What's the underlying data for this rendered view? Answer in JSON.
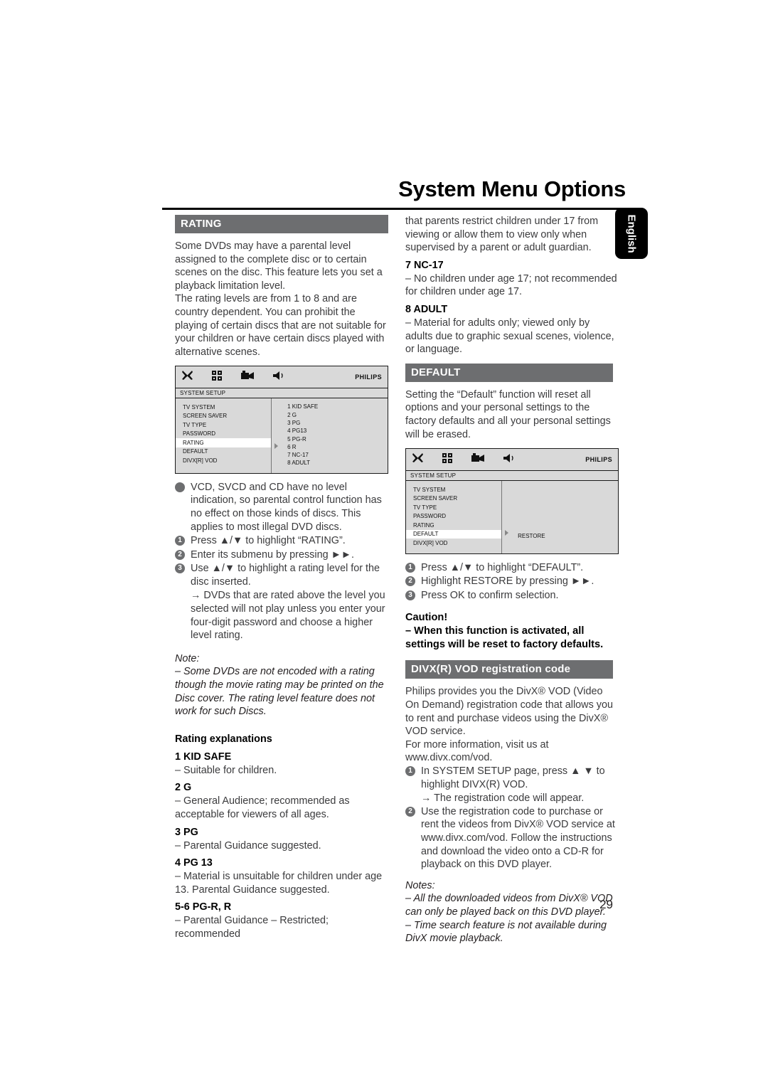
{
  "page": {
    "title": "System Menu Options",
    "language_tab": "English",
    "page_number": "29"
  },
  "left_column": {
    "rating_heading": "RATING",
    "intro_p1": "Some DVDs may have a parental level assigned to the complete disc or to certain scenes on the disc. This feature lets you set a playback limitation level.",
    "intro_p2": "The rating levels are from 1 to 8 and are country dependent. You can prohibit the playing of certain discs that are not suitable for your children or have certain discs played with alternative scenes.",
    "osd": {
      "header_label": "SYSTEM SETUP",
      "brand": "PHILIPS",
      "icons": [
        "tools-icon",
        "preferences-icon",
        "video-icon",
        "audio-icon"
      ],
      "menu_items": [
        "TV SYSTEM",
        "SCREEN SAVER",
        "TV TYPE",
        "PASSWORD",
        "RATING",
        "DEFAULT",
        "DIVX[R] VOD"
      ],
      "selected_item": "RATING",
      "options": [
        "1 KID SAFE",
        "2 G",
        "3 PG",
        "4 PG13",
        "5 PG-R",
        "6 R",
        "7 NC-17",
        "8 ADULT"
      ],
      "pointer_at_option": "6 R"
    },
    "bullet_note": "VCD, SVCD and CD have no level indication, so parental control function has no effect on those kinds of discs. This applies to most illegal DVD discs.",
    "steps": [
      "Press ▲/▼ to highlight “RATING”.",
      "Enter its submenu by pressing ►►.",
      "Use ▲/▼ to highlight a rating level for the disc inserted."
    ],
    "step_arrow": "→ DVDs that are rated above the level you selected will not play unless you enter your four-digit password and choose a higher level rating.",
    "note_label": "Note:",
    "note_text": "–  Some DVDs are not encoded with a rating though the movie rating may be printed on the Disc cover. The rating level feature does not work for such Discs.",
    "explanations_heading": "Rating explanations",
    "ratings": [
      {
        "label": "1 KID SAFE",
        "desc": "–   Suitable for children."
      },
      {
        "label": "2 G",
        "desc": "–   General Audience; recommended as acceptable for viewers of all ages."
      },
      {
        "label": "3 PG",
        "desc": "–   Parental Guidance suggested."
      },
      {
        "label": "4 PG 13",
        "desc": "–   Material is unsuitable for children under age 13. Parental Guidance suggested."
      },
      {
        "label": "5-6 PG-R, R",
        "desc": "–   Parental Guidance – Restricted; recommended"
      }
    ]
  },
  "right_column": {
    "continued_text": "that parents restrict children under 17 from viewing or allow them to view only when supervised by a parent or adult guardian.",
    "ratings": [
      {
        "label": "7 NC-17",
        "desc": "–   No children under age 17; not recommended for children under age 17."
      },
      {
        "label": "8 ADULT",
        "desc": "–   Material for adults only; viewed only by adults due to graphic sexual scenes, violence, or language."
      }
    ],
    "default_heading": "DEFAULT",
    "default_text": "Setting the “Default” function will reset all options and your personal settings to the factory defaults and all your personal settings will be erased.",
    "osd": {
      "header_label": "SYSTEM SETUP",
      "brand": "PHILIPS",
      "icons": [
        "tools-icon",
        "preferences-icon",
        "video-icon",
        "audio-icon"
      ],
      "menu_items": [
        "TV SYSTEM",
        "SCREEN SAVER",
        "TV TYPE",
        "PASSWORD",
        "RATING",
        "DEFAULT",
        "DIVX[R] VOD"
      ],
      "selected_item": "DEFAULT",
      "options": [
        "RESTORE"
      ],
      "pointer_at_option": "RESTORE"
    },
    "steps": [
      "Press ▲/▼ to highlight “DEFAULT”.",
      "Highlight RESTORE by pressing ►►.",
      "Press OK to confirm selection."
    ],
    "step3_bold": "OK",
    "caution_label": "Caution!",
    "caution_text": "–   When this function is activated, all settings will be reset to factory defaults.",
    "divx_heading": "DIVX(R) VOD registration code",
    "divx_p1": "Philips provides you the DivX® VOD (Video On Demand) registration code that allows you to rent and purchase videos using the DivX® VOD service.",
    "divx_p2": "For more information, visit us at www.divx.com/vod.",
    "divx_steps": [
      "In SYSTEM SETUP page, press ▲ ▼ to highlight DIVX(R) VOD.",
      "Use the registration code to purchase or rent the videos from DivX® VOD service at www.divx.com/vod. Follow the instructions and download the video onto a CD-R for playback on this DVD player."
    ],
    "divx_step1_arrow": "→ The registration code will appear.",
    "notes_label": "Notes:",
    "notes": [
      "–   All the downloaded videos from DivX® VOD can only be played back on this DVD player.",
      "–   Time search feature is not available during DivX movie playback."
    ]
  },
  "colors": {
    "section_bar": "#6d6e70",
    "text": "#3b3b3d",
    "osd_background": "#d9d9d9"
  }
}
